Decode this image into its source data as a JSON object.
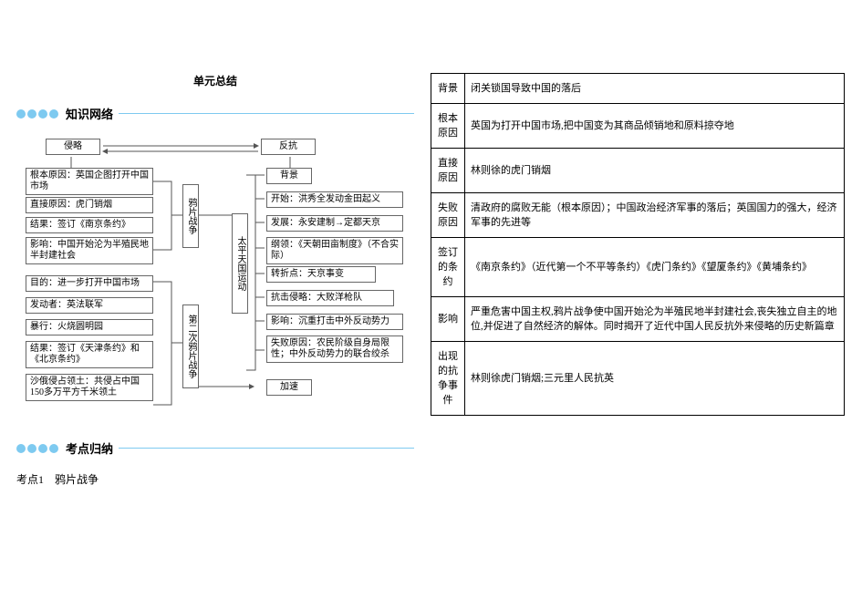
{
  "unit_title": "单元总结",
  "section_knowledge": "知识网络",
  "section_points": "考点归纳",
  "exam_point_1": "考点1　鸦片战争",
  "diagram": {
    "top_left": "侵略",
    "top_right": "反抗",
    "war1_label": "鸦片战争",
    "war2_label": "第二次鸦片战争",
    "taiping_label": "太平天国运动",
    "left": {
      "a": "根本原因：英国企图打开中国市场",
      "b": "直接原因：虎门销烟",
      "c": "结果：签订《南京条约》",
      "d": "影响：中国开始沦为半殖民地半封建社会",
      "e": "目的：进一步打开中国市场",
      "f": "发动者：英法联军",
      "g": "暴行：火烧圆明园",
      "h": "结果：签订《天津条约》和《北京条约》",
      "i": "沙俄侵占领土：共侵占中国150多万平方千米领土"
    },
    "right": {
      "r1": "背景",
      "r2": "开始：洪秀全发动金田起义",
      "r3": "发展：永安建制→定都天京",
      "r4": "纲领：《天朝田亩制度》（不合实际）",
      "r5": "转折点：天京事变",
      "r6": "抗击侵略：大败洋枪队",
      "r7": "影响：沉重打击中外反动势力",
      "r8": "失败原因：农民阶级自身局限性；中外反动势力的联合绞杀",
      "r9": "加速"
    }
  },
  "table": {
    "rows": [
      {
        "label": "背景",
        "content": "闭关锁国导致中国的落后"
      },
      {
        "label": "根本原因",
        "content": "英国为打开中国市场,把中国变为其商品倾销地和原料掠夺地"
      },
      {
        "label": "直接原因",
        "content": "林则徐的虎门销烟"
      },
      {
        "label": "失败原因",
        "content": "清政府的腐败无能（根本原因）；中国政治经济军事的落后；英国国力的强大，经济军事的先进等"
      },
      {
        "label": "签订的条约",
        "content": "《南京条约》（近代第一个不平等条约）《虎门条约》《望厦条约》《黄埔条约》"
      },
      {
        "label": "影响",
        "content": "严重危害中国主权,鸦片战争使中国开始沦为半殖民地半封建社会,丧失独立自主的地位,并促进了自然经济的解体。同时揭开了近代中国人民反抗外来侵略的历史新篇章"
      },
      {
        "label": "出现的抗争事件",
        "content": "林则徐虎门销烟;三元里人民抗英"
      }
    ]
  }
}
